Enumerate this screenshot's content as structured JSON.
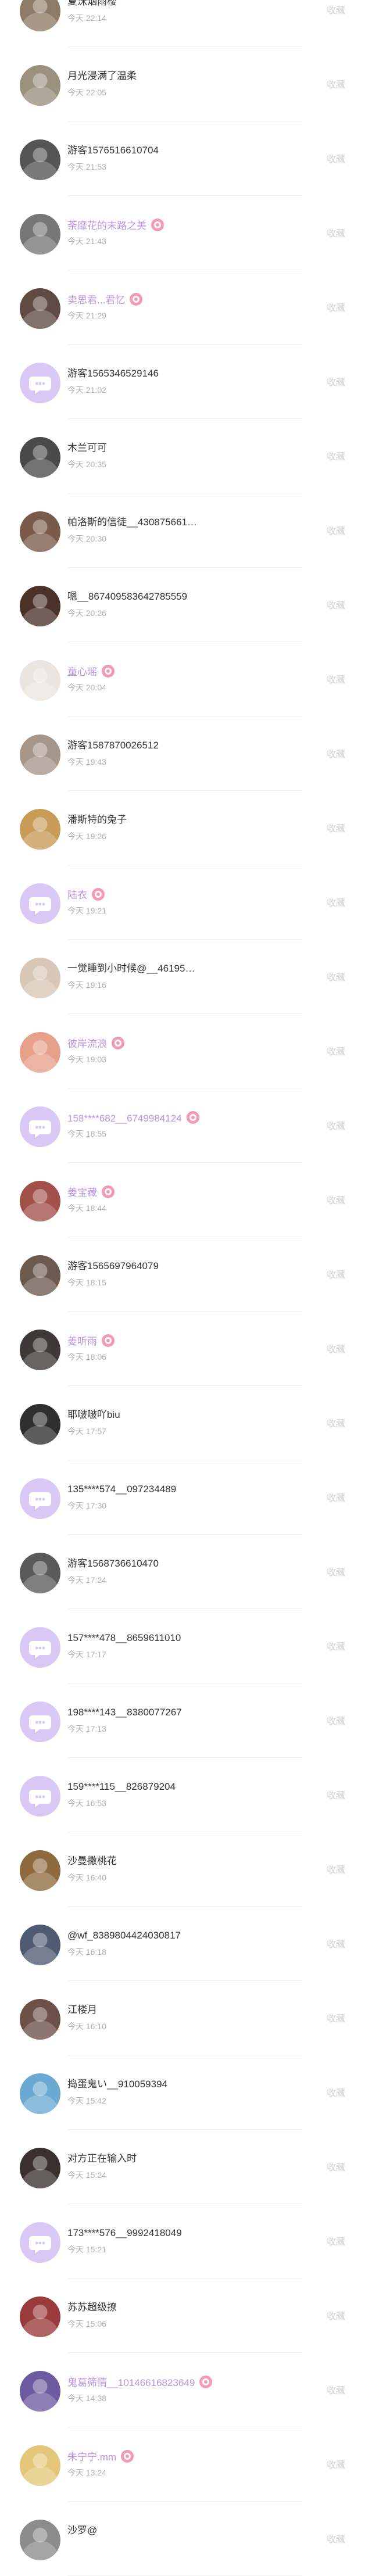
{
  "action_label": "收藏",
  "visitors": [
    {
      "name": "夏沫烟雨楼",
      "time": "今天 22:14",
      "vip": false,
      "avatar": "photo",
      "tone": "#8e7b67"
    },
    {
      "name": "月光浸满了温柔",
      "time": "今天 22:05",
      "vip": false,
      "avatar": "photo",
      "tone": "#9a917f"
    },
    {
      "name": "游客1576516610704",
      "time": "今天 21:53",
      "vip": false,
      "avatar": "photo",
      "tone": "#555555"
    },
    {
      "name": "荼靡花的末路之美",
      "time": "今天 21:43",
      "vip": true,
      "avatar": "photo",
      "tone": "#777777"
    },
    {
      "name": "卖思君...君忆",
      "time": "今天 21:29",
      "vip": true,
      "avatar": "photo",
      "tone": "#5f4a44"
    },
    {
      "name": "游客1565346529146",
      "time": "今天 21:02",
      "vip": false,
      "avatar": "chat-bubble",
      "tone": "#d9c8f6"
    },
    {
      "name": "木兰可可",
      "time": "今天 20:35",
      "vip": false,
      "avatar": "photo",
      "tone": "#4a4a4a"
    },
    {
      "name": "帕洛斯的信徒__430875661…",
      "time": "今天 20:30",
      "vip": false,
      "avatar": "photo",
      "tone": "#7a5a4a"
    },
    {
      "name": "嗯__8674095836427855​59",
      "time": "今天 20:26",
      "vip": false,
      "avatar": "photo",
      "tone": "#4a3228"
    },
    {
      "name": "童心瑶",
      "time": "今天 20:04",
      "vip": true,
      "avatar": "photo",
      "tone": "#eae5df"
    },
    {
      "name": "游客1587870026512",
      "time": "今天 19:43",
      "vip": false,
      "avatar": "photo",
      "tone": "#a7978a"
    },
    {
      "name": "潘斯特的兔子",
      "time": "今天 19:26",
      "vip": false,
      "avatar": "photo",
      "tone": "#c89b57"
    },
    {
      "name": "陆衣",
      "time": "今天 19:21",
      "vip": true,
      "avatar": "chat-bubble",
      "tone": "#d9c8f6"
    },
    {
      "name": "一觉睡到小时候@__46195…",
      "time": "今天 19:16",
      "vip": false,
      "avatar": "photo",
      "tone": "#d8c7b6"
    },
    {
      "name": "彼岸流浪",
      "time": "今天 19:03",
      "vip": true,
      "avatar": "photo",
      "tone": "#e7a089"
    },
    {
      "name": "158****682__6749984124",
      "time": "今天 18:55",
      "vip": true,
      "avatar": "chat-bubble",
      "tone": "#d9c8f6"
    },
    {
      "name": "姜宝藏",
      "time": "今天 18:44",
      "vip": true,
      "avatar": "photo",
      "tone": "#a4504a"
    },
    {
      "name": "游客1565697964079",
      "time": "今天 18:15",
      "vip": false,
      "avatar": "photo",
      "tone": "#6b5a4d"
    },
    {
      "name": "姜听雨",
      "time": "今天 18:06",
      "vip": true,
      "avatar": "photo",
      "tone": "#3e3838"
    },
    {
      "name": "耶啵啵吖biu",
      "time": "今天 17:57",
      "vip": false,
      "avatar": "photo",
      "tone": "#2f2f2f"
    },
    {
      "name": "135****574__097234489",
      "time": "今天 17:30",
      "vip": false,
      "avatar": "chat-bubble",
      "tone": "#d9c8f6"
    },
    {
      "name": "游客1568736610470",
      "time": "今天 17:24",
      "vip": false,
      "avatar": "photo",
      "tone": "#5a5a5a"
    },
    {
      "name": "157****478__8659611010",
      "time": "今天 17:17",
      "vip": false,
      "avatar": "chat-bubble",
      "tone": "#d9c8f6"
    },
    {
      "name": "198****143__8380077267",
      "time": "今天 17:13",
      "vip": false,
      "avatar": "chat-bubble",
      "tone": "#d9c8f6"
    },
    {
      "name": "159****115__826879204",
      "time": "今天 16:53",
      "vip": false,
      "avatar": "chat-bubble",
      "tone": "#d9c8f6"
    },
    {
      "name": "沙曼撒桃花",
      "time": "今天 16:40",
      "vip": false,
      "avatar": "photo",
      "tone": "#8f6a3f"
    },
    {
      "name": "@wf_8389804424030817",
      "time": "今天 16:18",
      "vip": false,
      "avatar": "photo",
      "tone": "#4e5b73"
    },
    {
      "name": "江楼月",
      "time": "今天 16:10",
      "vip": false,
      "avatar": "photo",
      "tone": "#6d5048"
    },
    {
      "name": "捣蛋鬼い__910059394",
      "time": "今天 15:42",
      "vip": false,
      "avatar": "photo",
      "tone": "#6aaad2"
    },
    {
      "name": "对方正在输入时",
      "time": "今天 15:24",
      "vip": false,
      "avatar": "photo",
      "tone": "#3b3030"
    },
    {
      "name": "173****576__9992418049",
      "time": "今天 15:21",
      "vip": false,
      "avatar": "chat-bubble",
      "tone": "#d9c8f6"
    },
    {
      "name": "苏苏超级撩",
      "time": "今天 15:06",
      "vip": false,
      "avatar": "photo",
      "tone": "#9a3a3a"
    },
    {
      "name": "鬼葛筛情__101466168​23649",
      "time": "今天 14:38",
      "vip": true,
      "avatar": "photo",
      "tone": "#6e5aa0"
    },
    {
      "name": "朱宁宁.mm",
      "time": "今天 13:24",
      "vip": true,
      "avatar": "photo",
      "tone": "#e4c77a"
    },
    {
      "name": "沙罗@",
      "time": "",
      "vip": false,
      "avatar": "photo",
      "tone": "#8c8c8c"
    }
  ]
}
